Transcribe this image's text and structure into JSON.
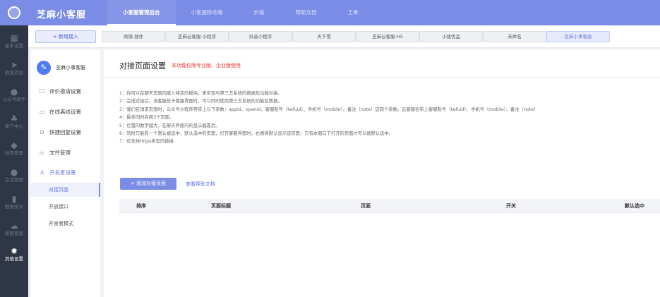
{
  "rail": {
    "items": [
      {
        "icon": "grid-icon",
        "label": "基本设置"
      },
      {
        "icon": "send-icon",
        "label": "群发消息"
      },
      {
        "icon": "chat-icon",
        "label": "公众号助手"
      },
      {
        "icon": "users-icon",
        "label": "客户中心"
      },
      {
        "icon": "tag-icon",
        "label": "标签管理"
      },
      {
        "icon": "message-icon",
        "label": "会话管理"
      },
      {
        "icon": "bar-chart-icon",
        "label": "数据统计"
      },
      {
        "icon": "cloud-icon",
        "label": "客服管理"
      },
      {
        "icon": "gear-icon",
        "label": "其他设置"
      }
    ]
  },
  "topbar": {
    "brand": "芝麻小客服",
    "nav": [
      "小客服管理后台",
      "小客服移动端",
      "价格",
      "帮助文档",
      "工单"
    ]
  },
  "channels": {
    "new_button": "+ 新增接入",
    "tabs": [
      "商铺-插件",
      "芝麻云客服-小程序",
      "抖音小程序",
      "天下雪",
      "芝麻云客服-H5",
      "小猪优品",
      "未命名",
      "芝麻小事客服"
    ]
  },
  "menu": {
    "account_name": "芝麻小事客服",
    "items": [
      {
        "icon": "edit-icon",
        "label": "评价邀请设置"
      },
      {
        "icon": "monitor-icon",
        "label": "在线离线设置"
      },
      {
        "icon": "reply-icon",
        "label": "快捷回复设置"
      },
      {
        "icon": "folder-icon",
        "label": "文件管理"
      },
      {
        "icon": "developer-icon",
        "label": "开发者设置"
      }
    ],
    "sub_items": [
      "对接页面",
      "开放接口",
      "开发者模式"
    ]
  },
  "main": {
    "title": "对接页面设置",
    "warning": "本功能仅限专业版、企业版使用",
    "notes": [
      "1：你可以在聊天页面内嵌入特定的模块，来实现与第三方系统的数据及功能对接。",
      "2：完成对接后，当客服处于客服界面时，可以同时使用第三方系统的功能及数据。",
      "3：我们在请求页面时，公众号小程序等带上以下参数：appid、openid、客服账号（kefuid）、手机号（mobile）、备注（note）这四个参数。云客服会带上客服账号（kefuid）、手机号（mobile）、备注（note）",
      "4：最多同时启用3个页面。",
      "5：位置的数字越大，在聊天界面内的显示越靠后。",
      "6：同时只能有一个默认被选中，默认选中的页面，打开客服界面时，右侧将默认显示该页面；只有本窗口下打开的页面才可以被默认选中。",
      "7：仅支持https类型的链接"
    ],
    "add_button": "+ 添加对接页面",
    "help_link": "查看帮助文档",
    "table_headers": [
      "排序",
      "页面标题",
      "页面",
      "开关",
      "默认选中"
    ]
  }
}
